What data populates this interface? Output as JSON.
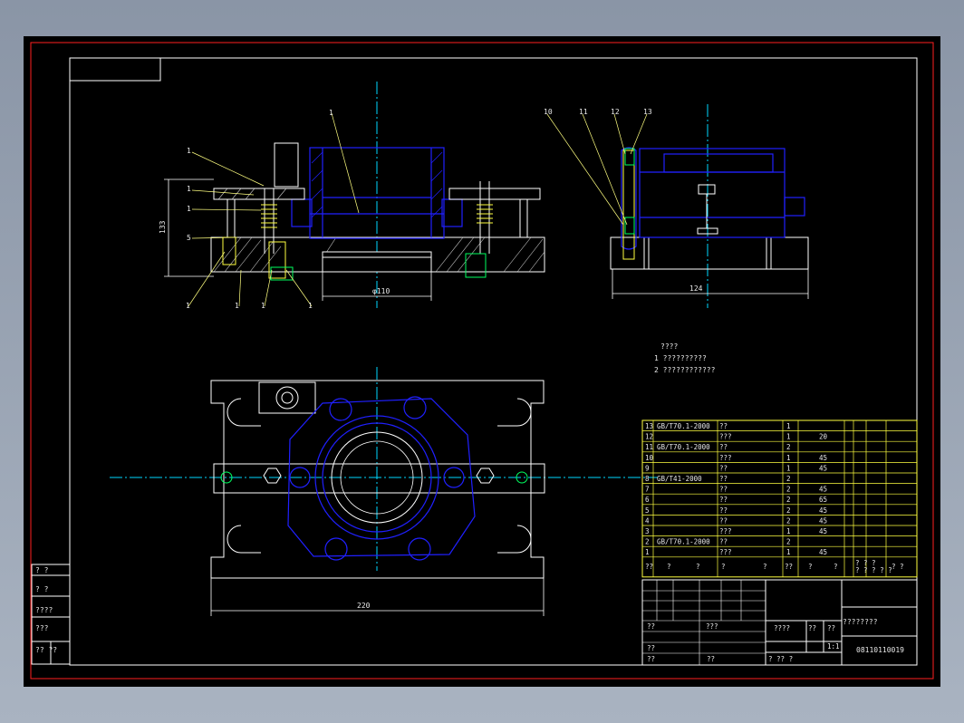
{
  "drawing": {
    "balloons_front": [
      "1",
      "1",
      "1",
      "1",
      "5",
      "1",
      "1",
      "1",
      "1",
      "1"
    ],
    "balloon_main": "1",
    "balloons_side": [
      "10",
      "11",
      "12",
      "13"
    ],
    "dim_height": "133",
    "dim_bore": "φ110",
    "dim_side": "124",
    "dim_width": "220",
    "notes": {
      "title": "????",
      "line1": "1 ??????????",
      "line2": "2 ????????????"
    },
    "bom": [
      {
        "no": "13",
        "std": "GB/T70.1-2000",
        "name": "??",
        "qty": "1",
        "mat": ""
      },
      {
        "no": "12",
        "std": "",
        "name": "???",
        "qty": "1",
        "mat": "20"
      },
      {
        "no": "11",
        "std": "GB/T70.1-2000",
        "name": "??",
        "qty": "2",
        "mat": ""
      },
      {
        "no": "10",
        "std": "",
        "name": "???",
        "qty": "1",
        "mat": "45"
      },
      {
        "no": "9",
        "std": "",
        "name": "??",
        "qty": "1",
        "mat": "45"
      },
      {
        "no": "8",
        "std": "GB/T41-2000",
        "name": "??",
        "qty": "2",
        "mat": ""
      },
      {
        "no": "7",
        "std": "",
        "name": "??",
        "qty": "2",
        "mat": "45"
      },
      {
        "no": "6",
        "std": "",
        "name": "??",
        "qty": "2",
        "mat": "65"
      },
      {
        "no": "5",
        "std": "",
        "name": "??",
        "qty": "2",
        "mat": "45"
      },
      {
        "no": "4",
        "std": "",
        "name": "??",
        "qty": "2",
        "mat": "45"
      },
      {
        "no": "3",
        "std": "",
        "name": "???",
        "qty": "1",
        "mat": "45"
      },
      {
        "no": "2",
        "std": "GB/T70.1-2000",
        "name": "??",
        "qty": "2",
        "mat": ""
      },
      {
        "no": "1",
        "std": "",
        "name": "???",
        "qty": "1",
        "mat": "45"
      }
    ],
    "bom_header": [
      "??",
      "?",
      "?",
      "?",
      "?",
      "??",
      "?",
      "?",
      "? ? ?\n? ? ? ? ?",
      "? ?"
    ],
    "title_block": {
      "design": "??",
      "std": "???",
      "review": "??",
      "process": "??",
      "approve": "??",
      "date": "??",
      "stage": "????",
      "weight": "??",
      "scale": "??",
      "scale_val": "1:1",
      "sheet": "?   ??   ?",
      "name": "????????",
      "code": "08110110019"
    },
    "sidebar": [
      "? ?",
      "? ?",
      "????",
      "???",
      "?? ??"
    ]
  }
}
